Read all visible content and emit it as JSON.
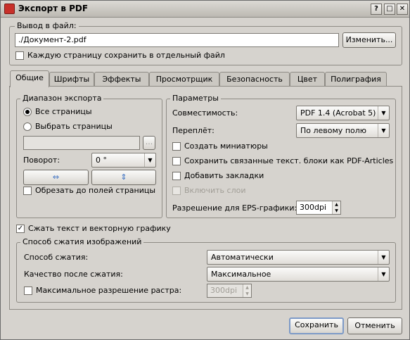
{
  "window": {
    "title": "Экспорт в PDF",
    "controls": [
      "?",
      "□",
      "✕"
    ]
  },
  "output": {
    "group_title": "Вывод в файл:",
    "file_value": "./Документ-2.pdf",
    "change_button": "Изменить...",
    "separate_files_label": "Каждую страницу сохранить в отдельный файл",
    "separate_files_checked": false
  },
  "tabs": [
    {
      "label": "Общие",
      "active": true
    },
    {
      "label": "Шрифты",
      "active": false
    },
    {
      "label": "Эффекты",
      "active": false
    },
    {
      "label": "Просмотрщик",
      "active": false
    },
    {
      "label": "Безопасность",
      "active": false
    },
    {
      "label": "Цвет",
      "active": false
    },
    {
      "label": "Полиграфия",
      "active": false
    }
  ],
  "export_range": {
    "group_title": "Диапазон экспорта",
    "all_pages": "Все страницы",
    "choose_pages": "Выбрать страницы",
    "pages_input": "",
    "pages_button": "...",
    "rotation_label": "Поворот:",
    "rotation_value": "0 °",
    "flip_h_icon": "flip-horizontal-icon",
    "flip_v_icon": "flip-vertical-icon",
    "crop_label": "Обрезать до полей страницы"
  },
  "params": {
    "group_title": "Параметры",
    "compat_label": "Совместимость:",
    "compat_value": "PDF 1.4 (Acrobat 5)",
    "binding_label": "Переплёт:",
    "binding_value": "По левому полю",
    "thumbnails": "Создать миниатюры",
    "articles": "Сохранить связанные текст. блоки как PDF-Articles",
    "bookmarks": "Добавить закладки",
    "layers": "Включить слои",
    "eps_label": "Разрешение для EPS-графики:",
    "eps_value": "300dpi"
  },
  "compress_text": {
    "label": "Сжать текст и векторную графику",
    "checked": true
  },
  "image_compression": {
    "group_title": "Способ сжатия изображений",
    "method_label": "Способ сжатия:",
    "method_value": "Автоматически",
    "quality_label": "Качество после сжатия:",
    "quality_value": "Максимальное",
    "max_res_label": "Максимальное разрешение растра:",
    "max_res_value": "300dpi"
  },
  "footer": {
    "save": "Сохранить",
    "cancel": "Отменить"
  }
}
